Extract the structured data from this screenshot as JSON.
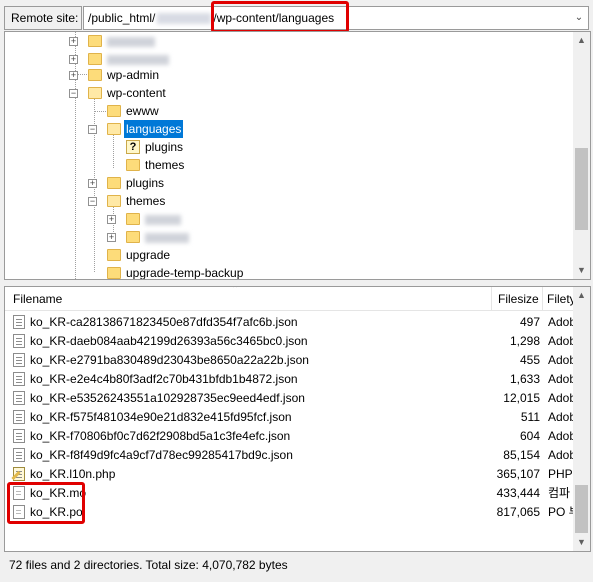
{
  "remote_site": {
    "label": "Remote site:",
    "path_prefix": "/public_html/",
    "path_suffix": "/wp-content/languages"
  },
  "tree": {
    "items": [
      {
        "label": "wp-admin"
      },
      {
        "label": "wp-content"
      },
      {
        "label": "ewww"
      },
      {
        "label": "languages"
      },
      {
        "label": "plugins"
      },
      {
        "label": "themes"
      },
      {
        "label": "plugins"
      },
      {
        "label": "themes"
      },
      {
        "label": "upgrade"
      },
      {
        "label": "upgrade-temp-backup"
      }
    ]
  },
  "file_list": {
    "columns": {
      "filename": "Filename",
      "filesize": "Filesize",
      "filetype": "Filety"
    },
    "rows": [
      {
        "name": "ko_KR-ca28138671823450e87dfd354f7afc6b.json",
        "size": "497",
        "type": "Adob"
      },
      {
        "name": "ko_KR-daeb084aab42199d26393a56c3465bc0.json",
        "size": "1,298",
        "type": "Adob"
      },
      {
        "name": "ko_KR-e2791ba830489d23043be8650a22a22b.json",
        "size": "455",
        "type": "Adob"
      },
      {
        "name": "ko_KR-e2e4c4b80f3adf2c70b431bfdb1b4872.json",
        "size": "1,633",
        "type": "Adob"
      },
      {
        "name": "ko_KR-e53526243551a102928735ec9eed4edf.json",
        "size": "12,015",
        "type": "Adob"
      },
      {
        "name": "ko_KR-f575f481034e90e21d832e415fd95fcf.json",
        "size": "511",
        "type": "Adob"
      },
      {
        "name": "ko_KR-f70806bf0c7d62f2908bd5a1c3fe4efc.json",
        "size": "604",
        "type": "Adob"
      },
      {
        "name": "ko_KR-f8f49d9fc4a9cf7d78ec99285417bd9c.json",
        "size": "85,154",
        "type": "Adob"
      },
      {
        "name": "ko_KR.l10n.php",
        "size": "365,107",
        "type": "PHP"
      },
      {
        "name": "ko_KR.mo",
        "size": "433,444",
        "type": "컴파"
      },
      {
        "name": "ko_KR.po",
        "size": "817,065",
        "type": "PO 부"
      }
    ]
  },
  "status": {
    "text": "72 files and 2 directories. Total size: 4,070,782 bytes"
  },
  "colors": {
    "highlight": "#e00000",
    "selection": "#0078d7",
    "folder": "#fddc7a"
  }
}
